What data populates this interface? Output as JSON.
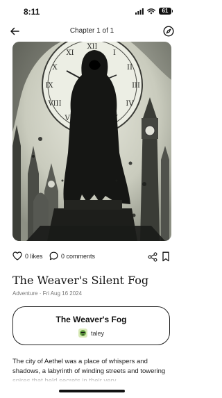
{
  "status_bar": {
    "time": "8:11",
    "battery": "61"
  },
  "nav": {
    "chapter_label": "Chapter 1 of 1"
  },
  "actions": {
    "likes": "0 likes",
    "comments": "0 comments"
  },
  "story": {
    "title": "The Weaver's Silent Fog",
    "meta": "Adventure · Fri Aug 16 2024",
    "body": "The city of Aethel was a place of whispers and shadows, a labyrinth of winding streets and towering spires that held secrets in their very"
  },
  "book_card": {
    "title": "The Weaver's Fog",
    "author": "taley"
  },
  "icons": {
    "back": "arrow-left-icon",
    "compass": "compass-icon",
    "heart": "heart-icon",
    "comment": "speech-bubble-icon",
    "share": "share-icon",
    "bookmark": "bookmark-icon"
  },
  "colors": {
    "text": "#111111",
    "meta": "#777777",
    "background": "#ffffff"
  }
}
